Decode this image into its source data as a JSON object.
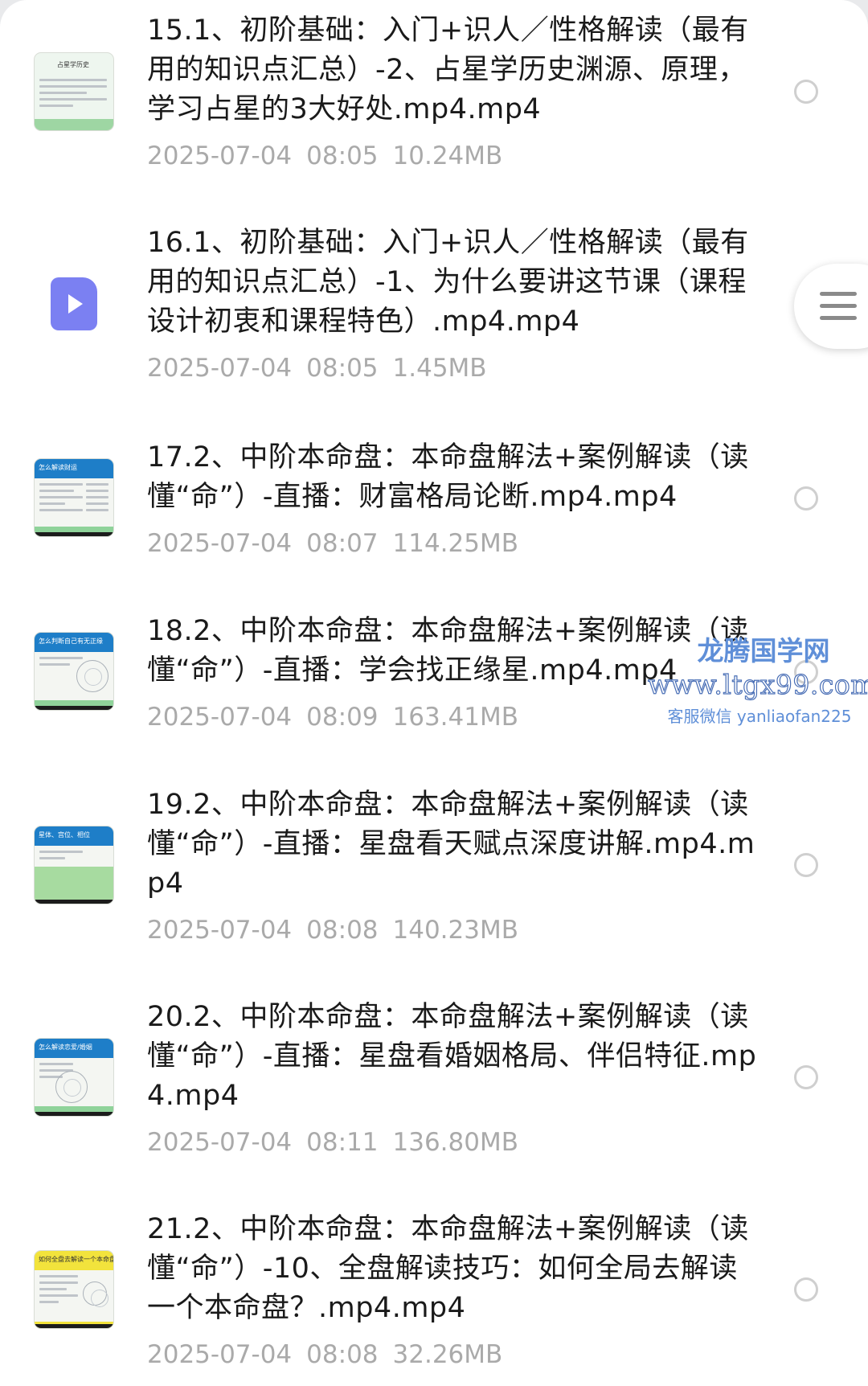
{
  "files": [
    {
      "title": "15.1、初阶基础：入门+识人／性格解读（最有用的知识点汇总）-2、占星学历史渊源、原理，学习占星的3大好处.mp4.mp4",
      "date": "2025-07-04",
      "time": "08:05",
      "size": "10.24MB",
      "thumb_caption": "占星学历史",
      "thumb_icon": "slide-thumbnail-icon"
    },
    {
      "title": "16.1、初阶基础：入门+识人／性格解读（最有用的知识点汇总）-1、为什么要讲这节课（课程设计初衷和课程特色）.mp4.mp4",
      "date": "2025-07-04",
      "time": "08:05",
      "size": "1.45MB",
      "thumb_icon": "video-file-icon"
    },
    {
      "title": "17.2、中阶本命盘：本命盘解法+案例解读（读懂“命”）-直播：财富格局论断.mp4.mp4",
      "date": "2025-07-04",
      "time": "08:07",
      "size": "114.25MB",
      "thumb_caption": "怎么解读财运",
      "thumb_icon": "slide-thumbnail-icon"
    },
    {
      "title": "18.2、中阶本命盘：本命盘解法+案例解读（读懂“命”）-直播：学会找正缘星.mp4.mp4",
      "date": "2025-07-04",
      "time": "08:09",
      "size": "163.41MB",
      "thumb_caption": "怎么判断自己有无正缘",
      "thumb_icon": "slide-thumbnail-icon"
    },
    {
      "title": "19.2、中阶本命盘：本命盘解法+案例解读（读懂“命”）-直播：星盘看天赋点深度讲解.mp4.mp4",
      "date": "2025-07-04",
      "time": "08:08",
      "size": "140.23MB",
      "thumb_caption": "星体、宫位、相位",
      "thumb_icon": "slide-thumbnail-icon"
    },
    {
      "title": "20.2、中阶本命盘：本命盘解法+案例解读（读懂“命”）-直播：星盘看婚姻格局、伴侣特征.mp4.mp4",
      "date": "2025-07-04",
      "time": "08:11",
      "size": "136.80MB",
      "thumb_caption": "怎么解读恋爱/婚姻",
      "thumb_icon": "slide-thumbnail-icon"
    },
    {
      "title": "21.2、中阶本命盘：本命盘解法+案例解读（读懂“命”）-10、全盘解读技巧：如何全局去解读一个本命盘？.mp4.mp4",
      "date": "2025-07-04",
      "time": "08:08",
      "size": "32.26MB",
      "thumb_caption": "如何全盘去解读一个本命盘",
      "thumb_icon": "slide-thumbnail-icon"
    }
  ],
  "watermark": {
    "title": "龙腾国学网",
    "url": "www.ltgx99.com",
    "contact": "客服微信 yanliaofan225"
  },
  "floating_menu": {
    "icon": "menu-icon"
  },
  "colors": {
    "title_text": "#1a1a1a",
    "meta_text": "#aaaaaa",
    "video_icon": "#7b80f2",
    "radio_border": "#cfcfcf",
    "watermark_blue": "#5f8fd8"
  }
}
